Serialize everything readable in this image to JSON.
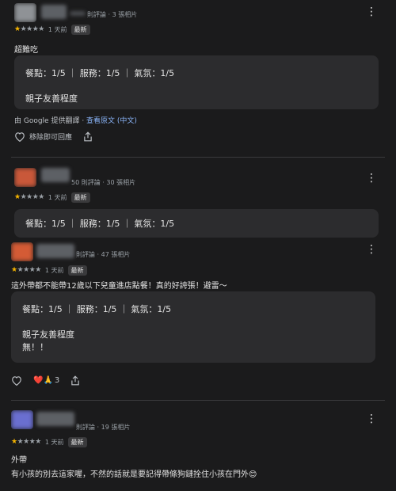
{
  "reviews": [
    {
      "meta": "則評論 · 3 張相片",
      "date": "1 天前",
      "badge": "最新",
      "text": "超難吃",
      "box_lines": [
        "餐點：1/5 ｜ 服務：1/5 ｜ 氣氛：1/5",
        "親子友善程度"
      ],
      "translate_prefix": "由 Google 提供翻譯 · ",
      "translate_link": "查看原文 (中文)",
      "like_label": "移除即可回應"
    },
    {
      "meta": "50 則評論 · 30 張相片",
      "date": "1 天前",
      "badge": "最新",
      "box_lines": [
        "餐點：1/5 ｜ 服務：1/5 ｜ 氣氛：1/5"
      ]
    },
    {
      "meta": "則評論 · 47 張相片",
      "date": "1 天前",
      "badge": "最新",
      "text": "這外帶都不能帶12歲以下兒童進店點餐！真的好誇張！避雷～",
      "box_lines": [
        "餐點：1/5 ｜ 服務：1/5 ｜ 氣氛：1/5",
        "親子友善程度",
        "無！！"
      ],
      "reaction_count": "3"
    },
    {
      "meta": "則評論 · 19 張相片",
      "date": "1 天前",
      "badge": "最新",
      "text": "外帶",
      "text2": "有小孩的別去這家喔，不然的話就是要記得帶條狗鏈拴住小孩在門外😊"
    }
  ],
  "icons": {
    "kebab": "⋮",
    "heart": "♡",
    "share": "share-icon",
    "reaction": "❤️🙏"
  },
  "colors": {
    "star": "#f5b400",
    "link": "#8ab4f8",
    "bg": "#1b1b1c",
    "box": "#2c2c2e"
  }
}
